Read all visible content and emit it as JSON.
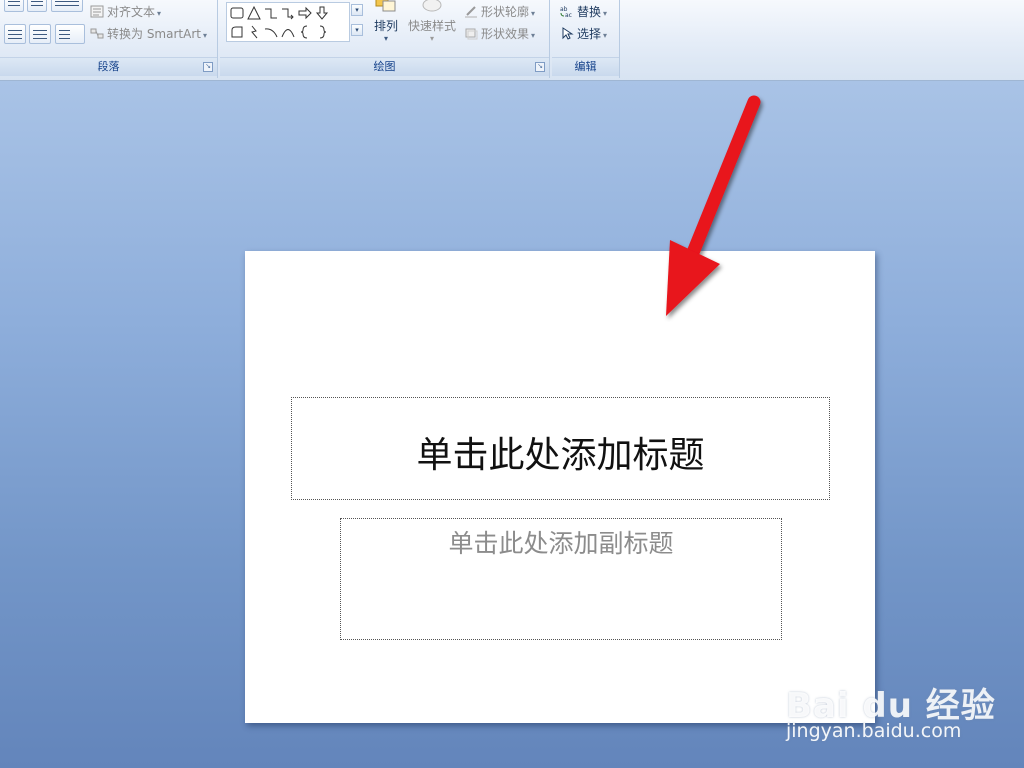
{
  "ribbon": {
    "paragraph": {
      "label": "段落",
      "align_text": "对齐文本",
      "convert_smartart": "转换为 SmartArt"
    },
    "drawing": {
      "label": "绘图",
      "arrange": "排列",
      "quick_styles": "快速样式",
      "shape_outline": "形状轮廓",
      "shape_effects": "形状效果"
    },
    "editing": {
      "label": "编辑",
      "replace": "替换",
      "select": "选择"
    }
  },
  "slide": {
    "title_placeholder": "单击此处添加标题",
    "subtitle_placeholder": "单击此处添加副标题"
  },
  "annotation": {
    "arrow_color": "#e8121b"
  },
  "watermark": {
    "logo": "Bai du 经验",
    "url": "jingyan.baidu.com"
  }
}
